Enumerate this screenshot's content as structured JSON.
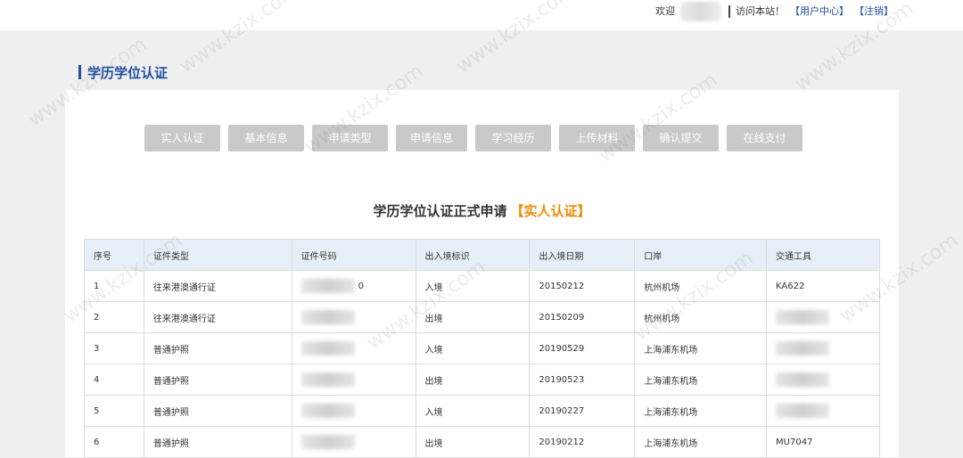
{
  "header": {
    "welcome_prefix": "欢迎",
    "welcome_suffix": "访问本站！",
    "user_center": "【用户中心】",
    "logout": "【注销】"
  },
  "section": {
    "title": "学历学位认证"
  },
  "steps": [
    "实人认证",
    "基本信息",
    "申请类型",
    "申请信息",
    "学习经历",
    "上传材料",
    "确认提交",
    "在线支付"
  ],
  "form": {
    "title": "学历学位认证正式申请",
    "highlight": "【实人认证】"
  },
  "table": {
    "headers": [
      "序号",
      "证件类型",
      "证件号码",
      "出入境标识",
      "出入境日期",
      "口岸",
      "交通工具"
    ],
    "rows": [
      [
        "1",
        "往来港澳通行证",
        "0",
        "入境",
        "20150212",
        "杭州机场",
        "KA622"
      ],
      [
        "2",
        "往来港澳通行证",
        "",
        "出境",
        "20150209",
        "杭州机场",
        ""
      ],
      [
        "3",
        "普通护照",
        "",
        "入境",
        "20190529",
        "上海浦东机场",
        ""
      ],
      [
        "4",
        "普通护照",
        "",
        "出境",
        "20190523",
        "上海浦东机场",
        ""
      ],
      [
        "5",
        "普通护照",
        "",
        "入境",
        "20190227",
        "上海浦东机场",
        ""
      ],
      [
        "6",
        "普通护照",
        "",
        "出境",
        "20190212",
        "上海浦东机场",
        "MU7047"
      ]
    ]
  },
  "watermark": "www.kzix.com",
  "colors": {
    "accent": "#1f4fa3",
    "highlight": "#f08a00",
    "step_bg": "#c9c9c9",
    "table_header_bg": "#e6eff7"
  }
}
